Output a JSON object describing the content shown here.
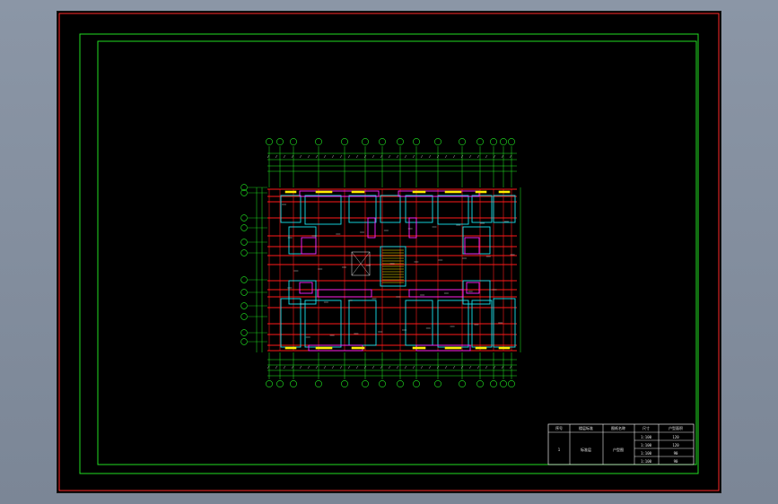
{
  "drawing": {
    "colors": {
      "outer_frame": "#ff2a2a",
      "inner_frame": "#22dd22",
      "axis": "#22ee22",
      "wall": "#ff1a1a",
      "cyan": "#18e4ee",
      "magenta": "#ff22ff",
      "yellow": "#ffee00",
      "white": "#e8e8e8"
    }
  },
  "title_block": {
    "header_cells": [
      "序号",
      "楼层标准",
      "图纸名称",
      "尺寸",
      "户型面积"
    ],
    "row_no": "1",
    "cells": [
      "标准层",
      "户型图"
    ],
    "rows": [
      {
        "size": "1:100",
        "val": "120"
      },
      {
        "size": "1:100",
        "val": "120"
      },
      {
        "size": "1:100",
        "val": "90"
      },
      {
        "size": "1:100",
        "val": "90"
      }
    ]
  }
}
